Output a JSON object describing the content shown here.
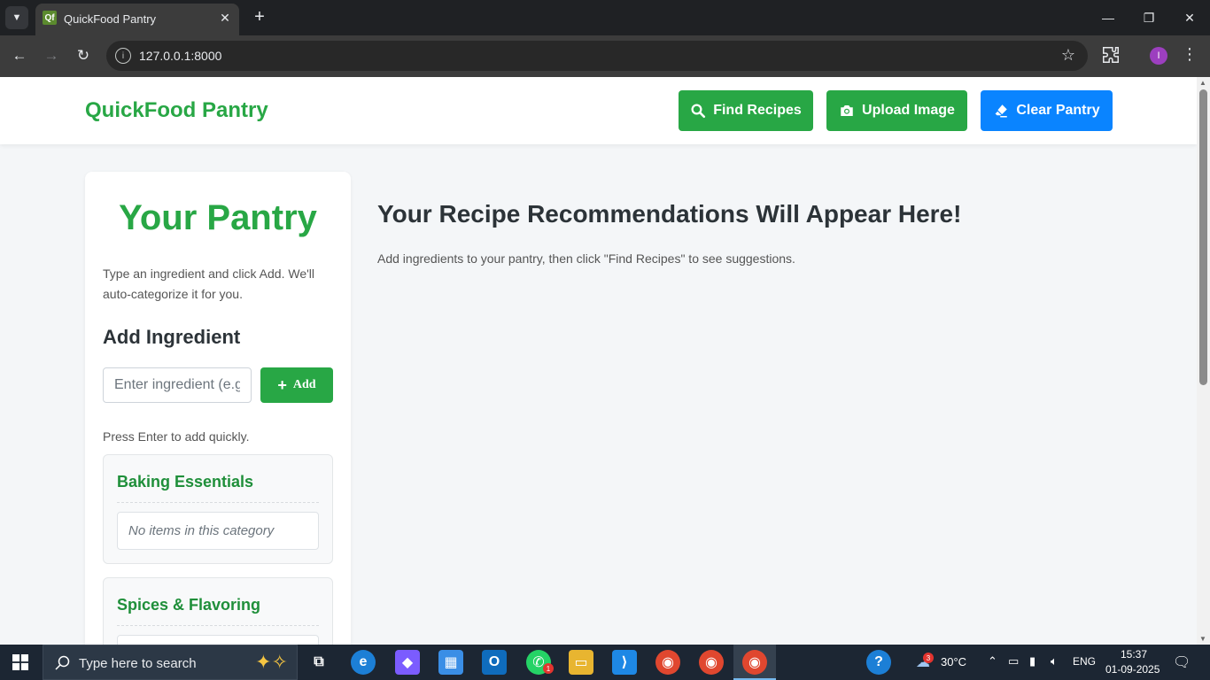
{
  "browser": {
    "tab_title": "QuickFood Pantry",
    "favicon_text": "Qf",
    "url": "127.0.0.1:8000",
    "profile_initial": "I"
  },
  "header": {
    "brand": "QuickFood Pantry",
    "buttons": {
      "find_recipes": "Find Recipes",
      "upload_image": "Upload Image",
      "clear_pantry": "Clear Pantry"
    }
  },
  "sidebar": {
    "title": "Your Pantry",
    "description": "Type an ingredient and click Add. We'll auto-categorize it for you.",
    "add_heading": "Add Ingredient",
    "input_placeholder": "Enter ingredient (e.g",
    "add_button": "Add",
    "enter_hint": "Press Enter to add quickly.",
    "categories": [
      {
        "title": "Baking Essentials",
        "empty_text": "No items in this category"
      },
      {
        "title": "Spices & Flavoring",
        "empty_text": ""
      }
    ]
  },
  "main": {
    "title": "Your Recipe Recommendations Will Appear Here!",
    "description": "Add ingredients to your pantry, then click \"Find Recipes\" to see suggestions."
  },
  "taskbar": {
    "search_placeholder": "Type here to search",
    "weather": "30°C",
    "weather_badge": "3",
    "whatsapp_badge": "1",
    "language": "ENG",
    "time": "15:37",
    "date": "01-09-2025"
  },
  "colors": {
    "brand_green": "#28a745",
    "clear_blue": "#0a84ff"
  }
}
